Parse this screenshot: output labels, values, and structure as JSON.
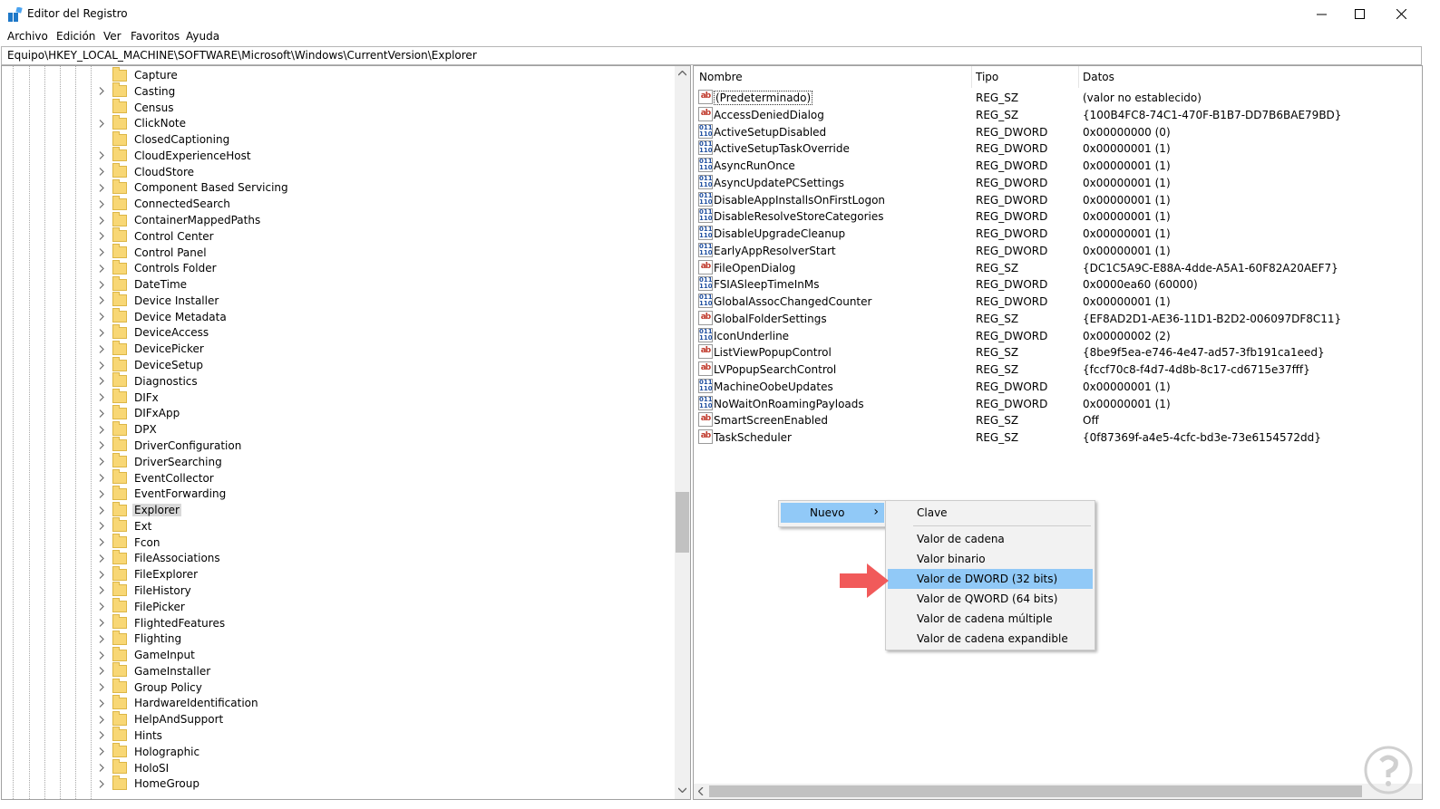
{
  "window": {
    "title": "Editor del Registro",
    "minimize": "—",
    "maximize": "☐",
    "close": "✕"
  },
  "menu": [
    "Archivo",
    "Edición",
    "Ver",
    "Favoritos",
    "Ayuda"
  ],
  "address": "Equipo\\HKEY_LOCAL_MACHINE\\SOFTWARE\\Microsoft\\Windows\\CurrentVersion\\Explorer",
  "tree": {
    "items": [
      {
        "label": "Capture",
        "expander": false
      },
      {
        "label": "Casting",
        "expander": true
      },
      {
        "label": "Census",
        "expander": false
      },
      {
        "label": "ClickNote",
        "expander": true
      },
      {
        "label": "ClosedCaptioning",
        "expander": false
      },
      {
        "label": "CloudExperienceHost",
        "expander": true
      },
      {
        "label": "CloudStore",
        "expander": true
      },
      {
        "label": "Component Based Servicing",
        "expander": true
      },
      {
        "label": "ConnectedSearch",
        "expander": true
      },
      {
        "label": "ContainerMappedPaths",
        "expander": true
      },
      {
        "label": "Control Center",
        "expander": true
      },
      {
        "label": "Control Panel",
        "expander": true
      },
      {
        "label": "Controls Folder",
        "expander": true
      },
      {
        "label": "DateTime",
        "expander": true
      },
      {
        "label": "Device Installer",
        "expander": true
      },
      {
        "label": "Device Metadata",
        "expander": true
      },
      {
        "label": "DeviceAccess",
        "expander": true
      },
      {
        "label": "DevicePicker",
        "expander": true
      },
      {
        "label": "DeviceSetup",
        "expander": true
      },
      {
        "label": "Diagnostics",
        "expander": true
      },
      {
        "label": "DIFx",
        "expander": true
      },
      {
        "label": "DIFxApp",
        "expander": true
      },
      {
        "label": "DPX",
        "expander": true
      },
      {
        "label": "DriverConfiguration",
        "expander": true
      },
      {
        "label": "DriverSearching",
        "expander": true
      },
      {
        "label": "EventCollector",
        "expander": true
      },
      {
        "label": "EventForwarding",
        "expander": true
      },
      {
        "label": "Explorer",
        "expander": true,
        "selected": true
      },
      {
        "label": "Ext",
        "expander": true
      },
      {
        "label": "Fcon",
        "expander": true
      },
      {
        "label": "FileAssociations",
        "expander": true
      },
      {
        "label": "FileExplorer",
        "expander": true
      },
      {
        "label": "FileHistory",
        "expander": true
      },
      {
        "label": "FilePicker",
        "expander": true
      },
      {
        "label": "FlightedFeatures",
        "expander": true
      },
      {
        "label": "Flighting",
        "expander": true
      },
      {
        "label": "GameInput",
        "expander": true
      },
      {
        "label": "GameInstaller",
        "expander": true
      },
      {
        "label": "Group Policy",
        "expander": true
      },
      {
        "label": "HardwareIdentification",
        "expander": true
      },
      {
        "label": "HelpAndSupport",
        "expander": true
      },
      {
        "label": "Hints",
        "expander": true
      },
      {
        "label": "Holographic",
        "expander": true
      },
      {
        "label": "HoloSI",
        "expander": true
      },
      {
        "label": "HomeGroup",
        "expander": true
      }
    ]
  },
  "columns": {
    "name": "Nombre",
    "type": "Tipo",
    "data": "Datos"
  },
  "values": [
    {
      "name": "(Predeterminado)",
      "type": "REG_SZ",
      "data": "(valor no establecido)",
      "icon": "string-value-icon"
    },
    {
      "name": "AccessDeniedDialog",
      "type": "REG_SZ",
      "data": "{100B4FC8-74C1-470F-B1B7-DD7B6BAE79BD}",
      "icon": "string-value-icon"
    },
    {
      "name": "ActiveSetupDisabled",
      "type": "REG_DWORD",
      "data": "0x00000000 (0)",
      "icon": "binary-value-icon"
    },
    {
      "name": "ActiveSetupTaskOverride",
      "type": "REG_DWORD",
      "data": "0x00000001 (1)",
      "icon": "binary-value-icon"
    },
    {
      "name": "AsyncRunOnce",
      "type": "REG_DWORD",
      "data": "0x00000001 (1)",
      "icon": "binary-value-icon"
    },
    {
      "name": "AsyncUpdatePCSettings",
      "type": "REG_DWORD",
      "data": "0x00000001 (1)",
      "icon": "binary-value-icon"
    },
    {
      "name": "DisableAppInstallsOnFirstLogon",
      "type": "REG_DWORD",
      "data": "0x00000001 (1)",
      "icon": "binary-value-icon"
    },
    {
      "name": "DisableResolveStoreCategories",
      "type": "REG_DWORD",
      "data": "0x00000001 (1)",
      "icon": "binary-value-icon"
    },
    {
      "name": "DisableUpgradeCleanup",
      "type": "REG_DWORD",
      "data": "0x00000001 (1)",
      "icon": "binary-value-icon"
    },
    {
      "name": "EarlyAppResolverStart",
      "type": "REG_DWORD",
      "data": "0x00000001 (1)",
      "icon": "binary-value-icon"
    },
    {
      "name": "FileOpenDialog",
      "type": "REG_SZ",
      "data": "{DC1C5A9C-E88A-4dde-A5A1-60F82A20AEF7}",
      "icon": "string-value-icon"
    },
    {
      "name": "FSIASleepTimeInMs",
      "type": "REG_DWORD",
      "data": "0x0000ea60 (60000)",
      "icon": "binary-value-icon"
    },
    {
      "name": "GlobalAssocChangedCounter",
      "type": "REG_DWORD",
      "data": "0x00000001 (1)",
      "icon": "binary-value-icon"
    },
    {
      "name": "GlobalFolderSettings",
      "type": "REG_SZ",
      "data": "{EF8AD2D1-AE36-11D1-B2D2-006097DF8C11}",
      "icon": "string-value-icon"
    },
    {
      "name": "IconUnderline",
      "type": "REG_DWORD",
      "data": "0x00000002 (2)",
      "icon": "binary-value-icon"
    },
    {
      "name": "ListViewPopupControl",
      "type": "REG_SZ",
      "data": "{8be9f5ea-e746-4e47-ad57-3fb191ca1eed}",
      "icon": "string-value-icon"
    },
    {
      "name": "LVPopupSearchControl",
      "type": "REG_SZ",
      "data": "{fccf70c8-f4d7-4d8b-8c17-cd6715e37fff}",
      "icon": "string-value-icon"
    },
    {
      "name": "MachineOobeUpdates",
      "type": "REG_DWORD",
      "data": "0x00000001 (1)",
      "icon": "binary-value-icon"
    },
    {
      "name": "NoWaitOnRoamingPayloads",
      "type": "REG_DWORD",
      "data": "0x00000001 (1)",
      "icon": "binary-value-icon"
    },
    {
      "name": "SmartScreenEnabled",
      "type": "REG_SZ",
      "data": "Off",
      "icon": "string-value-icon"
    },
    {
      "name": "TaskScheduler",
      "type": "REG_SZ",
      "data": "{0f87369f-a4e5-4cfc-bd3e-73e6154572dd}",
      "icon": "string-value-icon"
    }
  ],
  "icons": {
    "string_glyph": "ab",
    "binary_glyph": "011 110"
  },
  "context_menu": {
    "nuevo": "Nuevo",
    "arrow": "›",
    "items": [
      "Clave",
      "Valor de cadena",
      "Valor binario",
      "Valor de DWORD (32 bits)",
      "Valor de QWORD (64 bits)",
      "Valor de cadena múltiple",
      "Valor de cadena expandible"
    ],
    "highlighted": "Valor de DWORD (32 bits)"
  },
  "colors": {
    "selection": "#91c9f7",
    "arrow": "#f15a5a",
    "folder": "#f8d775"
  }
}
